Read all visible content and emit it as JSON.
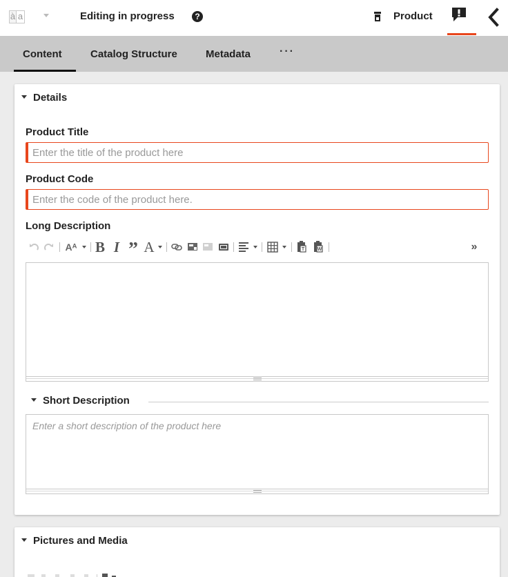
{
  "header": {
    "lang_icon_left": "à",
    "lang_icon_right": "a",
    "status": "Editing in progress",
    "help_glyph": "?",
    "product_label": "Product"
  },
  "tabs": [
    {
      "label": "Content",
      "active": true
    },
    {
      "label": "Catalog Structure",
      "active": false
    },
    {
      "label": "Metadata",
      "active": false
    }
  ],
  "tabs_more": "···",
  "details": {
    "title": "Details",
    "product_title": {
      "label": "Product Title",
      "placeholder": "Enter the title of the product here",
      "value": ""
    },
    "product_code": {
      "label": "Product Code",
      "placeholder": "Enter the code of the product here.",
      "value": ""
    },
    "long_description": {
      "label": "Long Description"
    },
    "short_description": {
      "title": "Short Description",
      "placeholder": "Enter a short description of the product here"
    }
  },
  "pictures": {
    "title": "Pictures and Media"
  },
  "toolbar_glyphs": {
    "font_size": "Aᴬ",
    "bold": "B",
    "italic": "I",
    "quote": "”",
    "font_color": "A",
    "more": "»"
  },
  "colors": {
    "accent": "#e8461c",
    "tabbar_bg": "#c9c9c9",
    "page_bg": "#ececec"
  }
}
